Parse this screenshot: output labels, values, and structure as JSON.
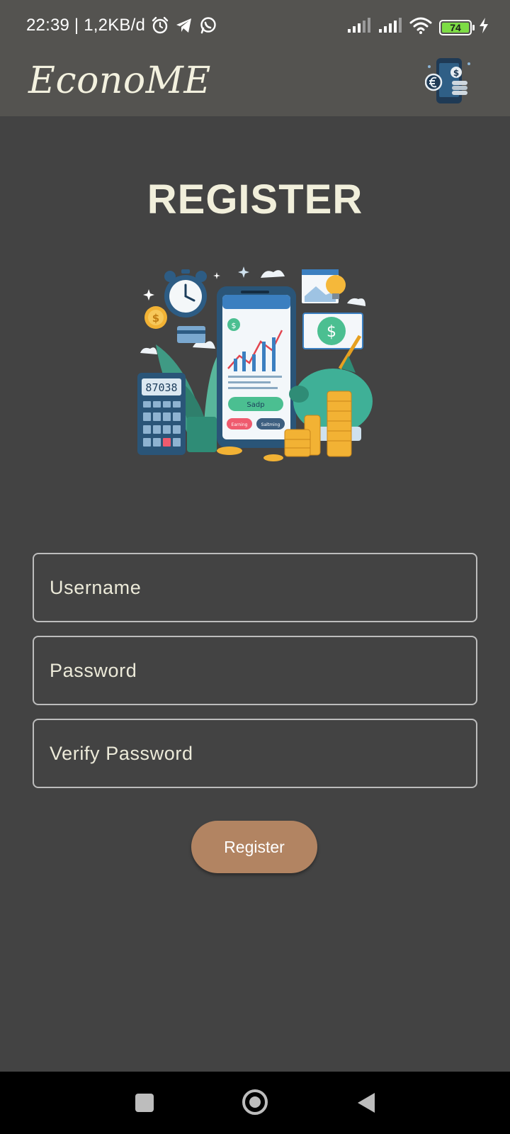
{
  "status_bar": {
    "time_speed": "22:39 | 1,2KB/d",
    "icons": [
      "alarm-icon",
      "telegram-icon",
      "whatsapp-icon",
      "signal-icon",
      "signal-icon",
      "wifi-icon",
      "battery-icon",
      "charging-icon"
    ],
    "battery_level": "74"
  },
  "app_bar": {
    "title": "EconoME",
    "logo_icon": "econome-logo-icon"
  },
  "page": {
    "heading": "REGISTER",
    "illustration": {
      "calculator_display": "87038",
      "phone_button": "Sadp",
      "phone_chip_left": "Earning",
      "phone_chip_right": "Saltming"
    }
  },
  "form": {
    "username_placeholder": "Username",
    "password_placeholder": "Password",
    "verify_password_placeholder": "Verify Password",
    "register_label": "Register"
  },
  "nav_bar": {
    "icons": [
      "recents-icon",
      "home-icon",
      "back-icon"
    ]
  },
  "colors": {
    "background": "#434343",
    "app_bar": "#545350",
    "heading": "#f1efdb",
    "button": "#b28462",
    "field_border": "#bdbdbd"
  }
}
